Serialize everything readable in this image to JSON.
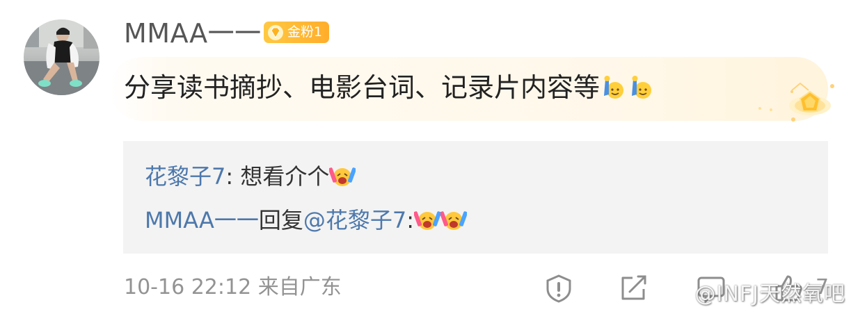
{
  "comment": {
    "username": "MMAA一一",
    "badge_label": "金粉1",
    "content": "分享读书摘抄、电影台词、记录片内容等",
    "content_emojis": [
      "raising-hand-emoji",
      "raising-hand-emoji"
    ]
  },
  "replies": [
    {
      "user": "花黎子7",
      "text": ": 想看介个",
      "emojis": [
        "excited-face-emoji"
      ]
    },
    {
      "user": "MMAA一一",
      "text": "回复",
      "mention": "@花黎子7",
      "suffix": ":",
      "emojis": [
        "excited-face-emoji",
        "excited-face-emoji"
      ]
    }
  ],
  "footer": {
    "meta": "10-16 22:12 来自广东",
    "like_count": "7",
    "icons": [
      "report-icon",
      "share-icon",
      "comment-icon",
      "like-icon"
    ]
  },
  "watermark": "@INFJ天然氧吧",
  "colors": {
    "link_blue": "#4d78ab",
    "badge_gold": "#ffb830",
    "muted": "#939393",
    "reply_bg": "#f3f3f3"
  }
}
